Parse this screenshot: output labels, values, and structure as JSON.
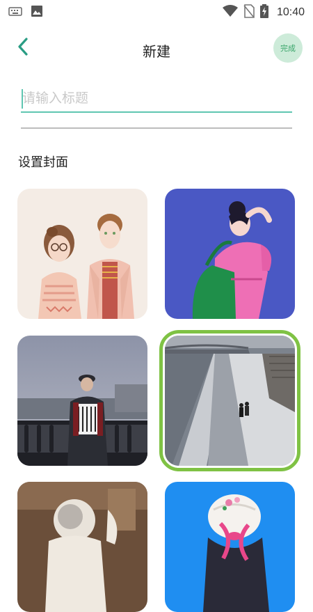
{
  "status_bar": {
    "time": "10:40",
    "icons": [
      "keyboard-icon",
      "image-icon",
      "wifi-icon",
      "no-sim-icon",
      "battery-charging-icon"
    ]
  },
  "nav": {
    "back_icon": "chevron-left-icon",
    "title": "新建",
    "done_label": "完成"
  },
  "title_input": {
    "placeholder": "请输入标题",
    "value": ""
  },
  "cover_section": {
    "label": "设置封面"
  },
  "covers": [
    {
      "name": "cover-illustration-couple",
      "selected": false
    },
    {
      "name": "cover-illustration-pink-shirt-woman",
      "selected": false
    },
    {
      "name": "cover-photo-accordion-player",
      "selected": false
    },
    {
      "name": "cover-photo-riverside-walk",
      "selected": true
    },
    {
      "name": "cover-photo-astronaut",
      "selected": false
    },
    {
      "name": "cover-illustration-hat-girl",
      "selected": false
    }
  ],
  "colors": {
    "accent": "#5fc6b1",
    "done_bg": "#cdebd9",
    "done_text": "#3aa56a",
    "selected_outline": "#7fc244"
  }
}
